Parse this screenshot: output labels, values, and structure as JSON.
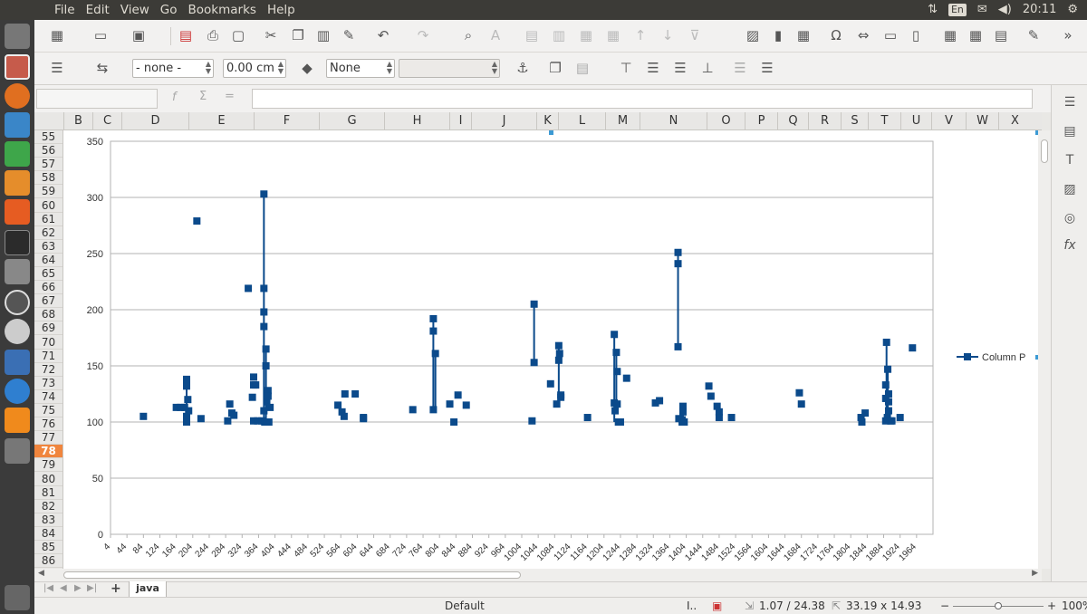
{
  "menubar": {
    "items": [
      "File",
      "Edit",
      "View",
      "Go",
      "Bookmarks",
      "Help"
    ],
    "keyboard_layout": "En",
    "time": "20:11"
  },
  "toolbar2": {
    "line_style": "- none -",
    "line_width": "0.00 cm",
    "area_style": "None"
  },
  "formula": {
    "fx": "f",
    "sigma": "Σ",
    "equals": "="
  },
  "columns": [
    "B",
    "C",
    "D",
    "E",
    "F",
    "G",
    "H",
    "I",
    "J",
    "K",
    "L",
    "M",
    "N",
    "O",
    "P",
    "Q",
    "R",
    "S",
    "T",
    "U",
    "V",
    "W",
    "X"
  ],
  "rows": [
    "55",
    "56",
    "57",
    "58",
    "59",
    "60",
    "61",
    "62",
    "63",
    "64",
    "65",
    "66",
    "67",
    "68",
    "69",
    "70",
    "71",
    "72",
    "73",
    "74",
    "75",
    "76",
    "77",
    "78",
    "79",
    "80",
    "81",
    "82",
    "83",
    "84",
    "85",
    "86"
  ],
  "selected_row": "78",
  "sheet_tab": "java",
  "status": {
    "page_style": "Default",
    "position": "1.07 / 24.38",
    "size": "33.19 x 14.93",
    "zoom": "100%"
  },
  "chart_data": {
    "type": "line",
    "y_ticks": [
      "0",
      "50",
      "100",
      "150",
      "200",
      "250",
      "300",
      "350"
    ],
    "ylim": [
      0,
      350
    ],
    "grid": true,
    "legend": "right",
    "series": [
      {
        "name": "Column P",
        "color": "#0b4a8b",
        "points": [
          [
            84,
            105
          ],
          [
            164,
            113
          ],
          [
            174,
            113
          ],
          [
            184,
            113
          ],
          [
            189,
            138
          ],
          [
            189,
            132
          ],
          [
            189,
            105
          ],
          [
            189,
            100
          ],
          [
            192,
            120
          ],
          [
            194,
            110
          ],
          [
            214,
            279
          ],
          [
            224,
            103
          ],
          [
            289,
            101
          ],
          [
            294,
            116
          ],
          [
            299,
            108
          ],
          [
            304,
            106
          ],
          [
            339,
            219
          ],
          [
            349,
            122
          ],
          [
            352,
            140
          ],
          [
            352,
            133
          ],
          [
            352,
            101
          ],
          [
            357,
            133
          ],
          [
            362,
            101
          ],
          [
            372,
            101
          ],
          [
            377,
            303
          ],
          [
            377,
            219
          ],
          [
            377,
            198
          ],
          [
            377,
            185
          ],
          [
            377,
            110
          ],
          [
            379,
            100
          ],
          [
            382,
            165
          ],
          [
            382,
            150
          ],
          [
            384,
            100
          ],
          [
            384,
            118
          ],
          [
            387,
            128
          ],
          [
            387,
            123
          ],
          [
            389,
            100
          ],
          [
            392,
            113
          ],
          [
            557,
            115
          ],
          [
            567,
            109
          ],
          [
            572,
            105
          ],
          [
            574,
            125
          ],
          [
            599,
            125
          ],
          [
            619,
            104
          ],
          [
            619,
            103
          ],
          [
            739,
            111
          ],
          [
            789,
            192
          ],
          [
            789,
            181
          ],
          [
            789,
            111
          ],
          [
            794,
            161
          ],
          [
            829,
            116
          ],
          [
            839,
            100
          ],
          [
            849,
            124
          ],
          [
            869,
            115
          ],
          [
            1029,
            101
          ],
          [
            1034,
            153
          ],
          [
            1034,
            205
          ],
          [
            1074,
            134
          ],
          [
            1089,
            116
          ],
          [
            1094,
            168
          ],
          [
            1094,
            155
          ],
          [
            1096,
            161
          ],
          [
            1099,
            124
          ],
          [
            1099,
            122
          ],
          [
            1164,
            104
          ],
          [
            1229,
            178
          ],
          [
            1229,
            117
          ],
          [
            1231,
            110
          ],
          [
            1234,
            162
          ],
          [
            1236,
            145
          ],
          [
            1236,
            116
          ],
          [
            1239,
            100
          ],
          [
            1244,
            100
          ],
          [
            1259,
            139
          ],
          [
            1329,
            117
          ],
          [
            1339,
            119
          ],
          [
            1384,
            251
          ],
          [
            1384,
            241
          ],
          [
            1384,
            167
          ],
          [
            1386,
            103
          ],
          [
            1394,
            102
          ],
          [
            1394,
            100
          ],
          [
            1396,
            114
          ],
          [
            1396,
            109
          ],
          [
            1399,
            100
          ],
          [
            1459,
            132
          ],
          [
            1464,
            123
          ],
          [
            1479,
            114
          ],
          [
            1484,
            109
          ],
          [
            1484,
            104
          ],
          [
            1514,
            104
          ],
          [
            1679,
            126
          ],
          [
            1684,
            116
          ],
          [
            1829,
            104
          ],
          [
            1831,
            100
          ],
          [
            1839,
            108
          ],
          [
            1889,
            121
          ],
          [
            1889,
            101
          ],
          [
            1889,
            133
          ],
          [
            1891,
            171
          ],
          [
            1893,
            104
          ],
          [
            1894,
            147
          ],
          [
            1896,
            110
          ],
          [
            1896,
            125
          ],
          [
            1896,
            118
          ],
          [
            1901,
            101
          ],
          [
            1904,
            101
          ],
          [
            1924,
            104
          ],
          [
            1954,
            166
          ]
        ],
        "segments": [
          [
            [
              189,
              138
            ],
            [
              189,
              100
            ]
          ],
          [
            [
              377,
              303
            ],
            [
              377,
              100
            ]
          ],
          [
            [
              382,
              165
            ],
            [
              382,
              100
            ]
          ],
          [
            [
              789,
              192
            ],
            [
              789,
              111
            ]
          ],
          [
            [
              794,
              161
            ],
            [
              794,
              110
            ]
          ],
          [
            [
              1034,
              205
            ],
            [
              1034,
              153
            ]
          ],
          [
            [
              1094,
              168
            ],
            [
              1094,
              124
            ]
          ],
          [
            [
              1229,
              178
            ],
            [
              1229,
              100
            ]
          ],
          [
            [
              1234,
              162
            ],
            [
              1234,
              116
            ]
          ],
          [
            [
              1384,
              251
            ],
            [
              1384,
              167
            ]
          ],
          [
            [
              1396,
              114
            ],
            [
              1396,
              100
            ]
          ],
          [
            [
              1891,
              171
            ],
            [
              1891,
              101
            ]
          ],
          [
            [
              1894,
              147
            ],
            [
              1894,
              101
            ]
          ]
        ]
      }
    ],
    "x_tick_labels": [
      "4",
      "44",
      "84",
      "124",
      "164",
      "204",
      "244",
      "284",
      "324",
      "364",
      "404",
      "444",
      "484",
      "524",
      "564",
      "604",
      "644",
      "684",
      "724",
      "764",
      "804",
      "844",
      "884",
      "924",
      "964",
      "1004",
      "1044",
      "1084",
      "1124",
      "1164",
      "1204",
      "1244",
      "1284",
      "1324",
      "1364",
      "1404",
      "1444",
      "1484",
      "1524",
      "1564",
      "1604",
      "1644",
      "1684",
      "1724",
      "1764",
      "1804",
      "1844",
      "1884",
      "1924",
      "1964"
    ]
  }
}
